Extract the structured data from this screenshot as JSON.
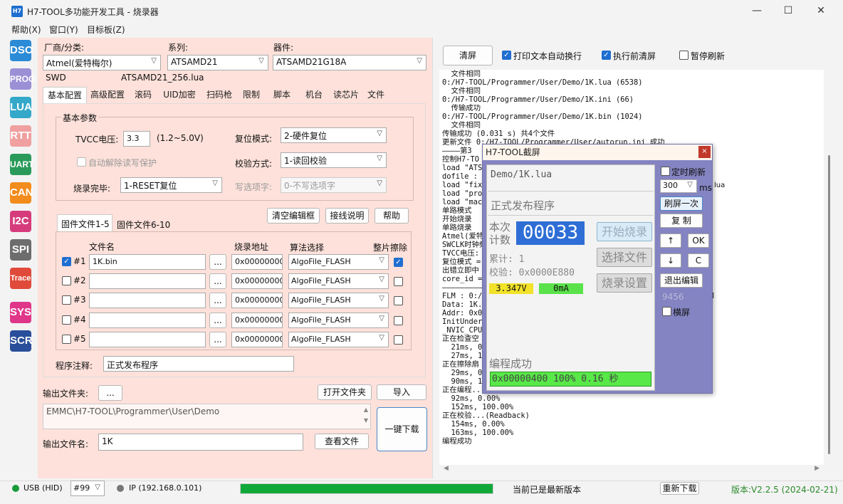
{
  "window": {
    "title": "H7-TOOL多功能开发工具 - 烧录器",
    "icon_text": "H7"
  },
  "menu": [
    "帮助(X)",
    "窗口(Y)",
    "目标板(Z)"
  ],
  "toolbar": [
    {
      "label": "DSO",
      "color": "#2b8bd6"
    },
    {
      "label": "PROG",
      "color": "#9b8fd6"
    },
    {
      "label": "LUA",
      "color": "#34a8c9"
    },
    {
      "label": "RTT",
      "color": "#f0a0a0"
    },
    {
      "label": "UART",
      "color": "#2a9a5a"
    },
    {
      "label": "CAN",
      "color": "#f28c1c"
    },
    {
      "label": "I2C",
      "color": "#d63c7c"
    },
    {
      "label": "SPI",
      "color": "#6d6d6d"
    },
    {
      "label": "Trace",
      "color": "#e04a3a"
    },
    {
      "label": "SYS",
      "color": "#e0368a"
    },
    {
      "label": "SCR",
      "color": "#2a4f9a"
    }
  ],
  "device": {
    "vendor_label": "厂商/分类:",
    "vendor_value": "Atmel(爱特梅尔)",
    "series_label": "系列:",
    "series_value": "ATSAMD21",
    "part_label": "器件:",
    "part_value": "ATSAMD21G18A",
    "interface": "SWD",
    "lua_file": "ATSAMD21_256.lua"
  },
  "tabs": [
    "基本配置",
    "高级配置",
    "滚码",
    "UID加密",
    "扫码枪",
    "限制",
    "脚本",
    "机台",
    "读芯片",
    "文件"
  ],
  "basic": {
    "group_title": "基本参数",
    "tvcc_label": "TVCC电压:",
    "tvcc_value": "3.3",
    "tvcc_range": "(1.2~5.0V)",
    "reset_label": "复位模式:",
    "reset_value": "2-硬件复位",
    "auto_unlock_label": "自动解除读写保护",
    "verify_label": "校验方式:",
    "verify_value": "1-读回校验",
    "done_label": "烧录完毕:",
    "done_value": "1-RESET复位",
    "opt_label": "写选项字:",
    "opt_value": "0-不写选项字"
  },
  "firmware": {
    "tab1": "固件文件1-5",
    "tab2": "固件文件6-10",
    "clear_btn": "清空编辑框",
    "wiring_btn": "接线说明",
    "help_btn": "帮助",
    "col_file": "文件名",
    "col_addr": "烧录地址",
    "col_algo": "算法选择",
    "col_erase": "整片擦除",
    "browse": "...",
    "rows": [
      {
        "no": "#1",
        "checked": true,
        "file": "1K.bin",
        "addr": "0x00000000",
        "algo": "AlgoFile_FLASH",
        "erase": true
      },
      {
        "no": "#2",
        "checked": false,
        "file": "",
        "addr": "0x00000000",
        "algo": "AlgoFile_FLASH",
        "erase": false
      },
      {
        "no": "#3",
        "checked": false,
        "file": "",
        "addr": "0x00000000",
        "algo": "AlgoFile_FLASH",
        "erase": false
      },
      {
        "no": "#4",
        "checked": false,
        "file": "",
        "addr": "0x00000000",
        "algo": "AlgoFile_FLASH",
        "erase": false
      },
      {
        "no": "#5",
        "checked": false,
        "file": "",
        "addr": "0x00000000",
        "algo": "AlgoFile_FLASH",
        "erase": false
      }
    ],
    "note_label": "程序注释:",
    "note_value": "正式发布程序"
  },
  "output": {
    "folder_label": "输出文件夹:",
    "folder_btn": "...",
    "open_folder_btn": "打开文件夹",
    "import_btn": "导入",
    "path": "EMMC\\H7-TOOL\\Programmer\\User\\Demo",
    "one_click_btn": "一键下载",
    "filename_label": "输出文件名:",
    "filename_value": "1K",
    "view_btn": "查看文件"
  },
  "log_toolbar": {
    "clear_btn": "清屏",
    "auto_wrap_label": "打印文本自动换行",
    "auto_wrap_checked": true,
    "clear_before_label": "执行前清屏",
    "clear_before_checked": true,
    "pause_label": "暂停刷新",
    "pause_checked": false
  },
  "log_lines": [
    "  文件相同",
    "0:/H7-TOOL/Programmer/User/Demo/1K.lua (6538)",
    "  文件相同",
    "0:/H7-TOOL/Programmer/User/Demo/1K.ini (66)",
    "  传输成功",
    "0:/H7-TOOL/Programmer/User/Demo/1K.bin (1024)",
    "  文件相同",
    "传输成功 (0.031 s) 共4个文件",
    "更新文件 0:/H7-TOOL/Programmer/User/autorun.ini 成功",
    "————第3",
    "控制H7-TO",
    "load \"ATSA",
    "dofile :",
    "load \"fix_",
    "load \"prog",
    "load \"mach",
    "单路模式",
    "开始烧录",
    "单路烧录",
    "Atmel(爱特",
    "SWCLK时钟频",
    "TVCC电压:",
    "复位模式 =",
    "出错立即中",
    "core_id =",
    "——————————",
    "FLM : 0:/H7-TOOL/Programmer/Device/Atmel/FLM/ATSAMD21_256.FLM",
    "Data: 1K.b",
    "Addr: 0x00",
    "InitUnderR",
    "_NVIC_CPUI",
    "正在检查空",
    "  21ms, 0.",
    "  27ms, 10",
    "正在擦除扇",
    "  29ms, 0.",
    "  90ms, 10",
    "正在编程...",
    "  92ms, 0.00%",
    "  152ms, 100.00%",
    "正在校验...(Readback)",
    "  154ms, 0.00%",
    "  163ms, 100.00%",
    "编程成功"
  ],
  "popup": {
    "title": "H7-TOOL截屏",
    "close": "×",
    "file": "Demo/1K.lua",
    "note": "正式发布程序",
    "count_label_1": "本次",
    "count_label_2": "计数",
    "count_value": "00033",
    "total_label": "累计:",
    "total_value": "1",
    "checksum_label": "校验:",
    "checksum_value": "0x0000E880",
    "voltage": "3.347V",
    "current": "0mA",
    "start_btn": "开始烧录",
    "select_btn": "选择文件",
    "settings_btn": "烧录设置",
    "result": "编程成功",
    "progress_text": "0x00000400  100%  0.16 秒",
    "timer_refresh_label": "定时刷新",
    "interval_value": "300",
    "interval_unit": "ms",
    "refresh_once_btn": "刷屏一次",
    "copy_btn": "复 制",
    "up_btn": "↑",
    "ok_btn": "OK",
    "down_btn": "↓",
    "c_btn": "C",
    "exit_edit_btn": "退出编辑",
    "code": "9456",
    "landscape_label": "横屏",
    "lua_suffix": "lua"
  },
  "status": {
    "usb": "USB (HID)",
    "device_no": "#99",
    "ip": "IP (192.168.0.101)",
    "progress": 1.0,
    "message": "当前已是最新版本",
    "redownload_btn": "重新下载",
    "version": "版本:V2.2.5 (2024-02-21)"
  }
}
